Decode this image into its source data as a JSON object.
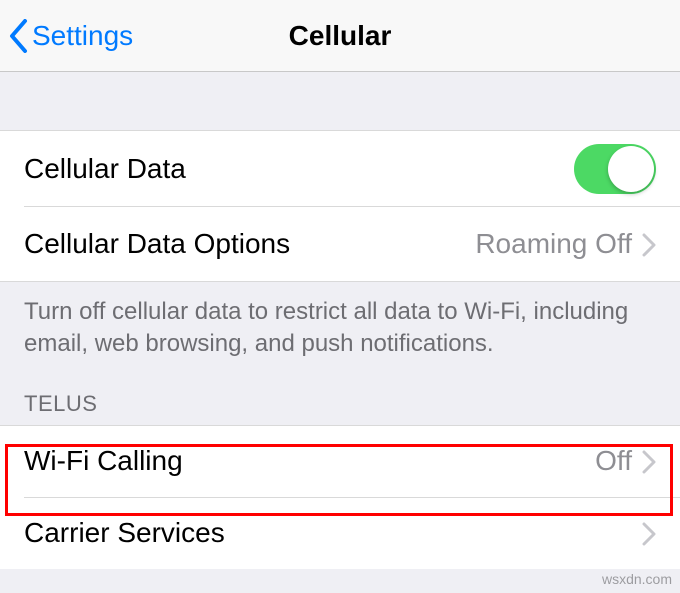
{
  "nav": {
    "back_label": "Settings",
    "title": "Cellular"
  },
  "group1": {
    "cellular_data_label": "Cellular Data",
    "cellular_data_on": true,
    "cellular_data_options_label": "Cellular Data Options",
    "cellular_data_options_value": "Roaming Off",
    "footer": "Turn off cellular data to restrict all data to Wi-Fi, including email, web browsing, and push notifications."
  },
  "group2": {
    "header": "TELUS",
    "wifi_calling_label": "Wi-Fi Calling",
    "wifi_calling_value": "Off",
    "carrier_services_label": "Carrier Services"
  },
  "watermark": "wsxdn.com"
}
